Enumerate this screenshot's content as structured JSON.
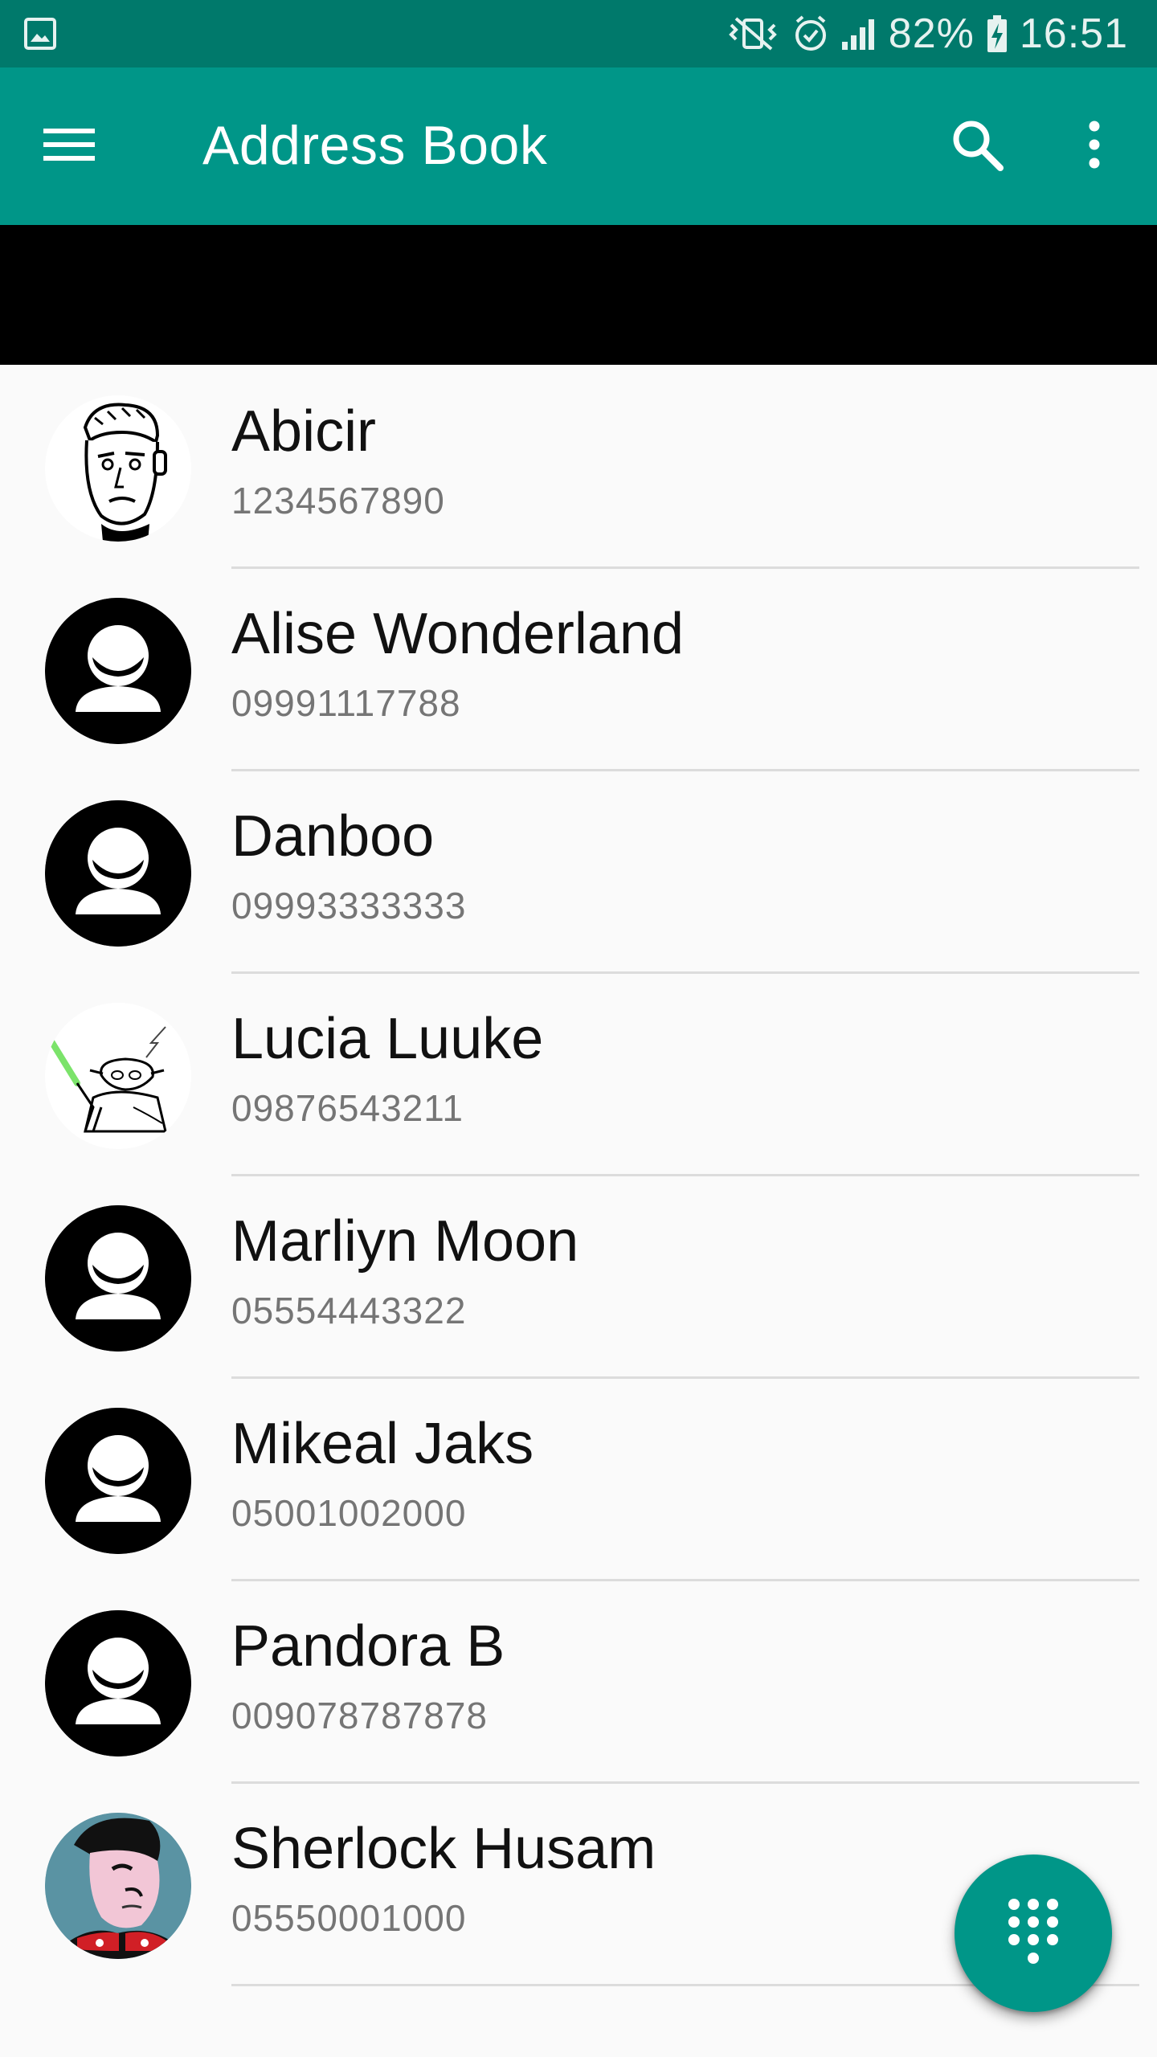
{
  "status_bar": {
    "battery_percent": "82%",
    "time": "16:51",
    "icons": [
      "gallery-icon",
      "vibrate-mute-icon",
      "alarm-icon",
      "signal-icon",
      "battery-charging-icon"
    ]
  },
  "app_bar": {
    "title": "Address Book",
    "icons": [
      "menu-icon",
      "search-icon",
      "more-vert-icon"
    ],
    "color": "#009688",
    "status_color": "#00796b"
  },
  "contacts": [
    {
      "name": "Abicir",
      "phone": "1234567890",
      "avatar": "sketch-face-photo"
    },
    {
      "name": "Alise Wonderland",
      "phone": "09991117788",
      "avatar": "default-person-icon"
    },
    {
      "name": "Danboo",
      "phone": "09993333333",
      "avatar": "default-person-icon"
    },
    {
      "name": "Lucia Luuke",
      "phone": "09876543211",
      "avatar": "yoda-sketch-photo"
    },
    {
      "name": "Marliyn Moon",
      "phone": "05554443322",
      "avatar": "default-person-icon"
    },
    {
      "name": "Mikeal Jaks",
      "phone": "05001002000",
      "avatar": "default-person-icon"
    },
    {
      "name": "Pandora B",
      "phone": "009078787878",
      "avatar": "default-person-icon"
    },
    {
      "name": "Sherlock Husam",
      "phone": "05550001000",
      "avatar": "cartoon-portrait-photo"
    }
  ],
  "fab": {
    "icon": "dialpad-icon",
    "color": "#009688"
  }
}
